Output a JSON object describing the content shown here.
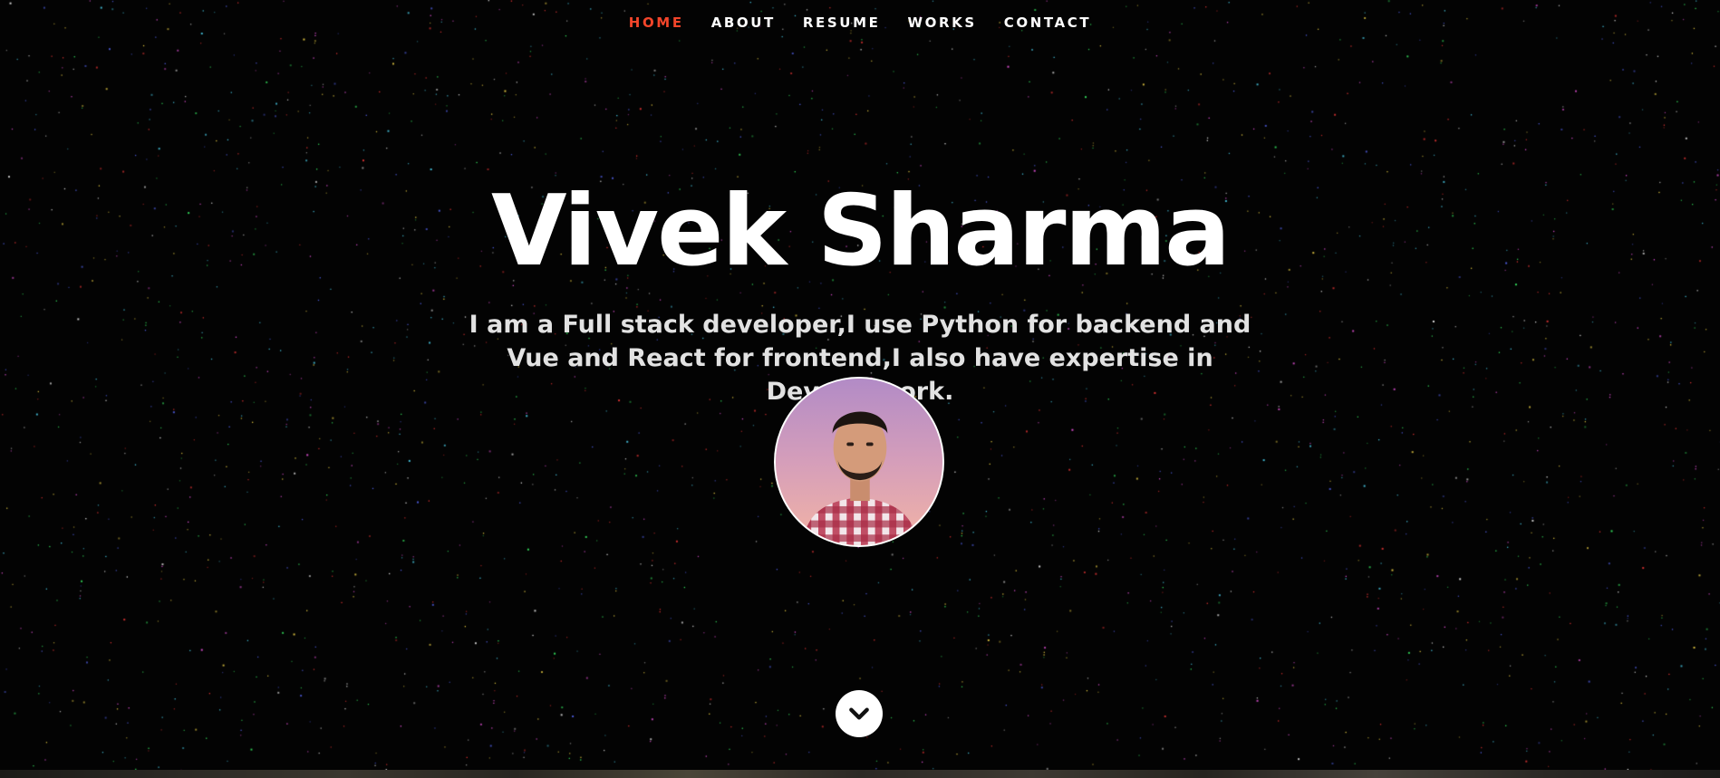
{
  "nav": {
    "items": [
      {
        "label": "HOME",
        "active": true
      },
      {
        "label": "ABOUT",
        "active": false
      },
      {
        "label": "RESUME",
        "active": false
      },
      {
        "label": "WORKS",
        "active": false
      },
      {
        "label": "CONTACT",
        "active": false
      }
    ]
  },
  "hero": {
    "name": "Vivek Sharma",
    "tagline": "I am a Full stack developer,I use Python for backend and Vue and React for frontend,I also have expertise in Devops work.",
    "avatar_icon": "profile-photo",
    "scroll_icon": "chevron-down-icon"
  },
  "colors": {
    "background": "#030303",
    "nav_active": "#f4452a",
    "text": "#ffffff",
    "tagline": "#e2e2e2"
  }
}
